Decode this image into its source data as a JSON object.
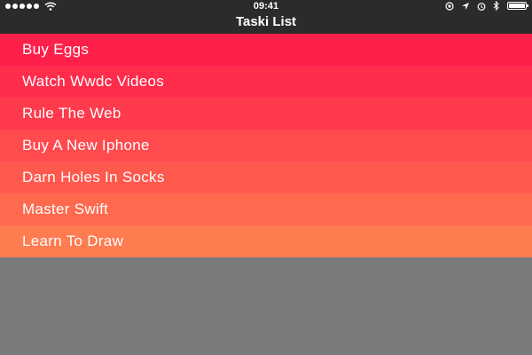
{
  "status_bar": {
    "time": "09:41",
    "left_icons": [
      "signal-dots-icon",
      "wifi-icon"
    ],
    "right_icons": [
      "at-icon",
      "location-arrow-icon",
      "alarm-icon",
      "bluetooth-icon",
      "battery-icon"
    ]
  },
  "nav": {
    "title": "Taski List"
  },
  "tasks": [
    {
      "label": "Buy Eggs",
      "color": "#ff1f4b"
    },
    {
      "label": "Watch Wwdc Videos",
      "color": "#ff2c4c"
    },
    {
      "label": "Rule The Web",
      "color": "#ff3a4d"
    },
    {
      "label": "Buy A New Iphone",
      "color": "#ff4a4e"
    },
    {
      "label": "Darn Holes In Socks",
      "color": "#ff594e"
    },
    {
      "label": "Master Swift",
      "color": "#ff6a4f"
    },
    {
      "label": "Learn To Draw",
      "color": "#ff7b50"
    }
  ],
  "colors": {
    "background": "#7b7b7b",
    "navbar": "#2b2b2b"
  }
}
